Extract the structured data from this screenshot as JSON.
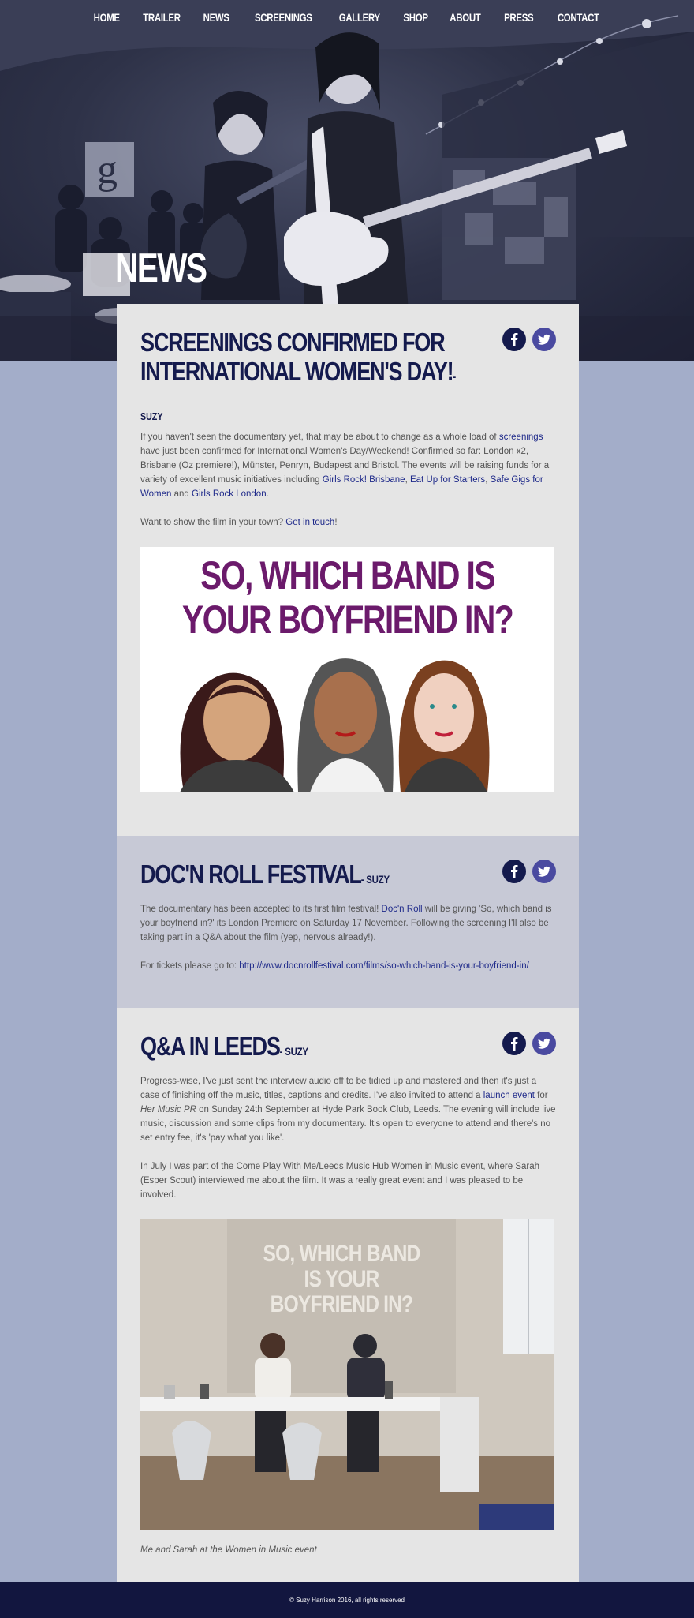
{
  "nav": {
    "items": [
      "HOME",
      "TRAILER",
      "NEWS",
      "SCREENINGS",
      "GALLERY",
      "SHOP",
      "ABOUT",
      "PRESS",
      "CONTACT"
    ]
  },
  "page": {
    "title": "NEWS"
  },
  "posts": [
    {
      "title": "SCREENINGS CONFIRMED FOR INTERNATIONAL WOMEN'S DAY!",
      "byline": "-",
      "author": "SUZY",
      "p1": {
        "t1": "If you haven't seen the documentary yet, that may be about to change as a whole load of ",
        "l1": "screenings",
        "t2": " have just been confirmed for International Women's Day/Weekend! Confirmed so far: London x2, Brisbane (Oz premiere!), Münster, Penryn, Budapest and Bristol. The events will be raising funds for a variety of excellent music initiatives including ",
        "l2": "Girls Rock! Brisbane",
        "t3": ", ",
        "l3": "Eat Up for Starters",
        "t4": ", ",
        "l4": "Safe Gigs for Women",
        "t5": " and ",
        "l5": "Girls Rock London",
        "t6": "."
      },
      "p2": {
        "t1": "Want to show the film in your town? ",
        "l1": "Get in touch",
        "t2": "!"
      },
      "image_text": "SO, WHICH BAND IS YOUR BOYFRIEND IN?"
    },
    {
      "title": "DOC'N ROLL FESTIVAL",
      "byline": "- SUZY",
      "p1": {
        "t1": "The documentary has been accepted to its first film festival! ",
        "l1": "Doc'n Roll",
        "t2": " will be giving 'So, which band is your boyfriend in?' its London Premiere on Saturday 17 November. Following the screening I'll also be taking part in a Q&A about the film (yep, nervous already!)."
      },
      "p2": {
        "t1": "For tickets please go to: ",
        "l1": "http://www.docnrollfestival.com/films/so-which-band-is-your-boyfriend-in/"
      }
    },
    {
      "title": "Q&A IN LEEDS",
      "byline": "- SUZY",
      "p1": {
        "t1": "Progress-wise, I've just sent the interview audio off to be tidied up and mastered and then it's just a case of finishing off the music, titles, captions and credits. I've also invited to attend a ",
        "l1": "launch event",
        "t2": " for ",
        "em": "Her Music PR",
        "t3": " on Sunday 24th September at Hyde Park Book Club, Leeds. The evening will include live music, discussion and some clips from my documentary. It's open to everyone to attend and there's no set entry fee, it's 'pay what you like'."
      },
      "p2": "In July I was part of the Come Play With Me/Leeds Music Hub Women in Music event, where Sarah (Esper Scout) interviewed me about the film. It was a really great event and I was pleased to be involved.",
      "image_text": "SO, WHICH BAND IS YOUR BOYFRIEND IN?",
      "caption": "Me and Sarah at the Women in Music event"
    }
  ],
  "footer": {
    "text": "© Suzy Harrison 2016, all rights reserved"
  },
  "colors": {
    "navy": "#141a4d",
    "link": "#1f2a8a",
    "page_bg": "#a3adc9",
    "post_bg": "#e5e5e5",
    "post_alt_bg": "#c7c9d6",
    "facebook_circle": "#141a4d",
    "twitter_circle": "#4a4aa0",
    "promo_title": "#6b1a6b"
  },
  "icons": [
    "facebook-icon",
    "twitter-icon"
  ]
}
